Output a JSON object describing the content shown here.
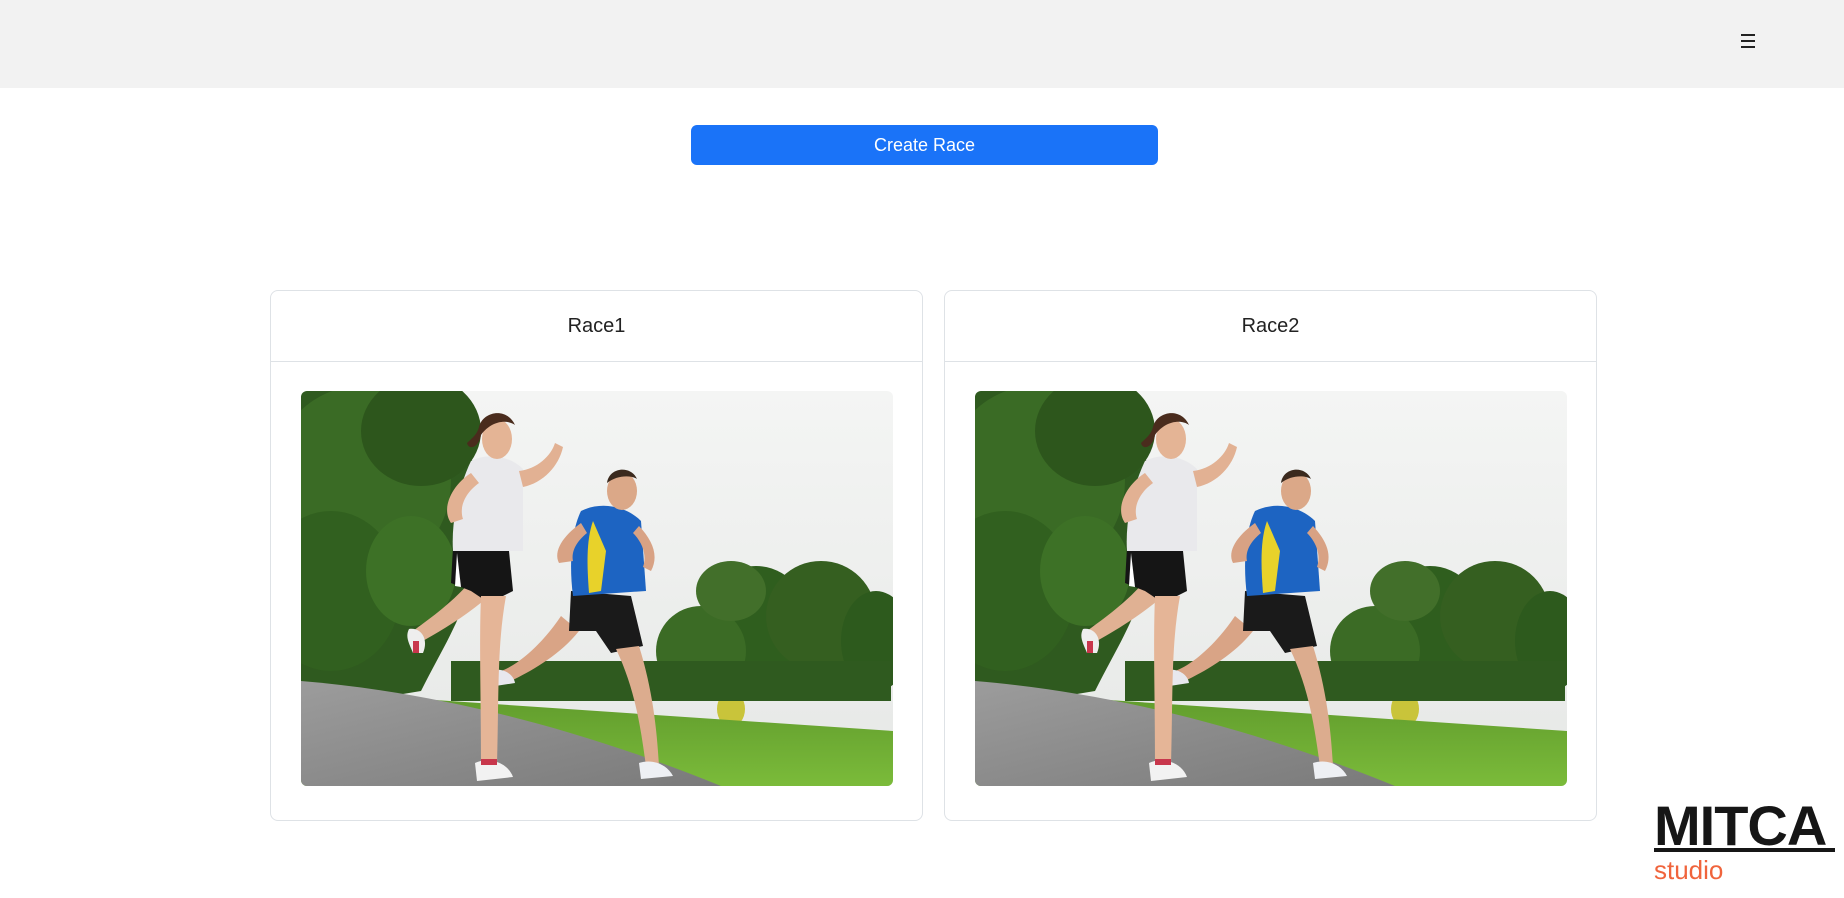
{
  "header": {
    "menu_icon": "hamburger-icon"
  },
  "actions": {
    "create_label": "Create Race",
    "accent_color": "#1a73f8"
  },
  "races": [
    {
      "title": "Race1",
      "image": "two-runners-in-park-photo"
    },
    {
      "title": "Race2",
      "image": "two-runners-in-park-photo"
    }
  ],
  "branding": {
    "logo_text": "MITCA",
    "logo_subtext": "studio",
    "logo_sub_color": "#f0643c"
  }
}
